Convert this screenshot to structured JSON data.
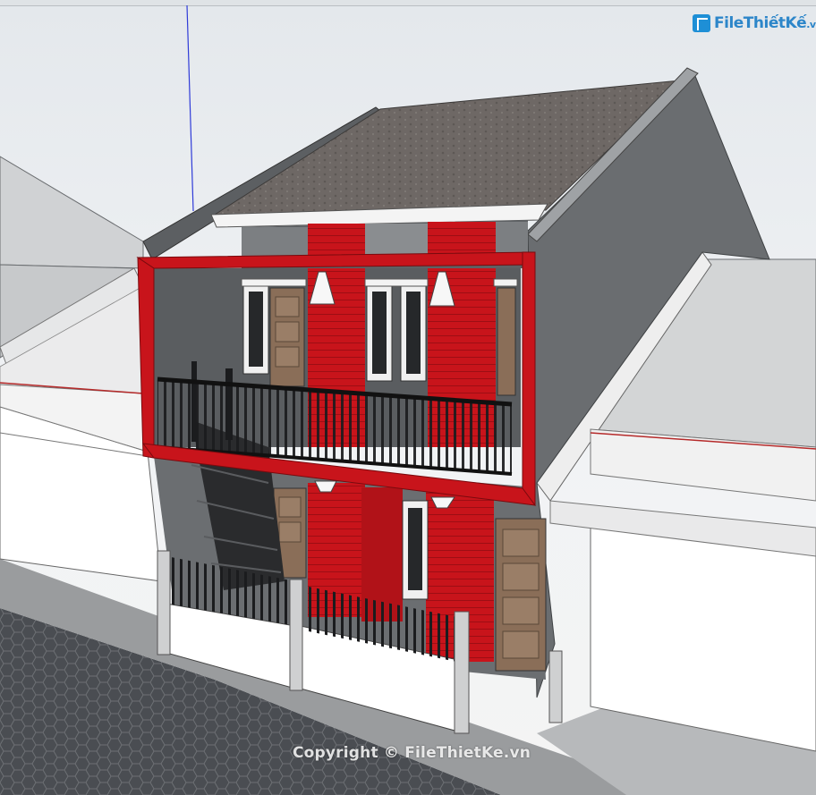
{
  "watermark": {
    "logo_brand": "FileThiếtKế",
    "logo_tld": ".vn",
    "copyright": "Copyright © FileThietKe.vn"
  },
  "colors": {
    "accent_red": "#c8141b",
    "roof": "#6e6865",
    "wall_gray": "#6a6d70",
    "sky": "#eceff2",
    "ground": "#4a4d52"
  },
  "icons": {
    "logo": "filethietke-logo-icon",
    "axis": "blue-z-axis-line"
  }
}
